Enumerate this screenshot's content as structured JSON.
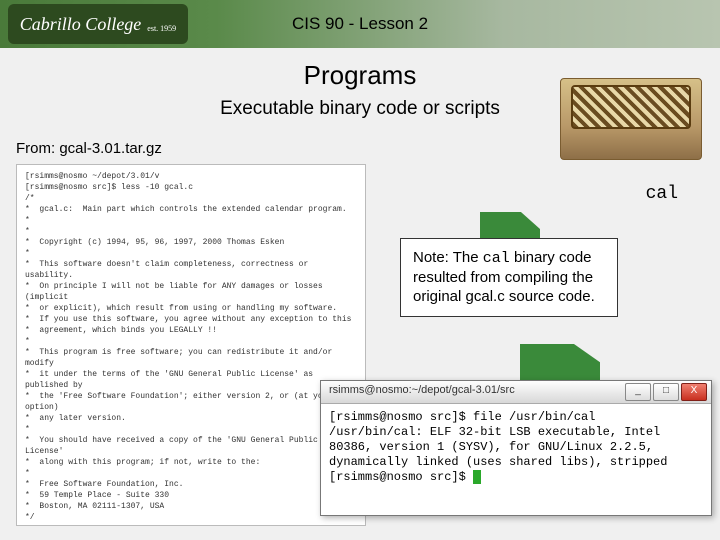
{
  "header": {
    "logo_text": "Cabrillo College",
    "logo_sub": "est. 1959",
    "course_title": "CIS 90 - Lesson 2"
  },
  "section": {
    "title": "Programs",
    "subtitle": "Executable binary code or scripts"
  },
  "from_line": "From:  gcal-3.01.tar.gz",
  "cal_label": "cal",
  "note": {
    "prefix": "Note:  The ",
    "code": "cal",
    "suffix": " binary code resulted from compiling the original gcal.c source code."
  },
  "source_panel": "[rsimms@nosmo ~/depot/3.01/v\n[rsimms@nosmo src]$ less -10 gcal.c\n/*\n*  gcal.c:  Main part which controls the extended calendar program.\n*\n*\n*  Copyright (c) 1994, 95, 96, 1997, 2000 Thomas Esken\n*\n*  This software doesn't claim completeness, correctness or usability.\n*  On principle I will not be liable for ANY damages or losses (implicit\n*  or explicit), which result from using or handling my software.\n*  If you use this software, you agree without any exception to this\n*  agreement, which binds you LEGALLY !!\n*\n*  This program is free software; you can redistribute it and/or modify\n*  it under the terms of the 'GNU General Public License' as published by\n*  the 'Free Software Foundation'; either version 2, or (at your option)\n*  any later version.\n*\n*  You should have received a copy of the 'GNU General Public License'\n*  along with this program; if not, write to the:\n*\n*  Free Software Foundation, Inc.\n*  59 Temple Place - Suite 330\n*  Boston, MA 02111-1307, USA\n*/\n\nstatic char rcsid[]=\"$Id: gcal.c ...\";\n\n/*\n*  Include header files.\n*/\n#include \"tailor.h\"\n#if HAVE_ASSERT_H\n# include <assert.h>\n#endif\n#if HAVE_CTYPE_H",
  "terminal": {
    "title": "rsimms@nosmo:~/depot/gcal-3.01/src",
    "min": "_",
    "max": "□",
    "close": "X",
    "lines": "[rsimms@nosmo src]$ file /usr/bin/cal\n/usr/bin/cal: ELF 32-bit LSB executable, Intel 80386, version 1 (SYSV), for GNU/Linux 2.2.5, dynamically linked (uses shared libs), stripped\n[rsimms@nosmo src]$ "
  }
}
